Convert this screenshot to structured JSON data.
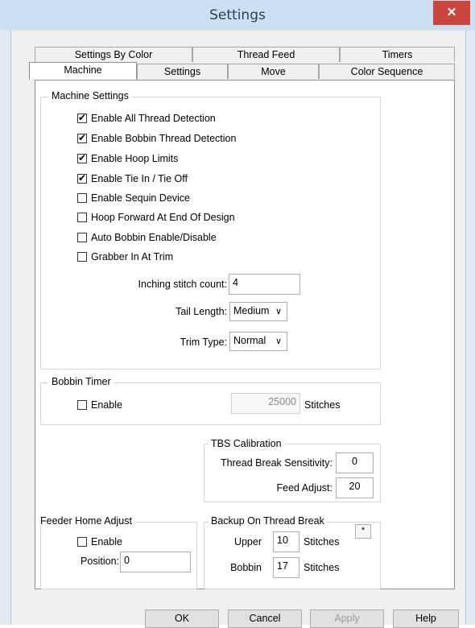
{
  "window": {
    "title": "Settings",
    "close_icon": "close-icon"
  },
  "tabs_row1": [
    "Settings By Color",
    "Thread Feed",
    "Timers"
  ],
  "tabs_row2": [
    "Machine",
    "Settings",
    "Move",
    "Color Sequence"
  ],
  "machine_settings": {
    "legend": "Machine Settings",
    "checkboxes": [
      {
        "label": "Enable All Thread Detection",
        "checked": true
      },
      {
        "label": "Enable Bobbin Thread Detection",
        "checked": true
      },
      {
        "label": "Enable Hoop Limits",
        "checked": true
      },
      {
        "label": "Enable Tie In / Tie Off",
        "checked": true
      },
      {
        "label": "Enable Sequin Device",
        "checked": false
      },
      {
        "label": "Hoop Forward At End Of Design",
        "checked": false
      },
      {
        "label": "Auto Bobbin Enable/Disable",
        "checked": false
      },
      {
        "label": "Grabber In At Trim",
        "checked": false
      }
    ],
    "inching_label": "Inching stitch count:",
    "inching_value": "4",
    "tail_label": "Tail Length:",
    "tail_value": "Medium",
    "trim_label": "Trim Type:",
    "trim_value": "Normal"
  },
  "bobbin_timer": {
    "legend": "Bobbin Timer",
    "enable_label": "Enable",
    "value": "25000",
    "unit": "Stitches"
  },
  "tbs_calibration": {
    "legend": "TBS Calibration",
    "sensitivity_label": "Thread Break Sensitivity:",
    "sensitivity_value": "0",
    "feed_label": "Feed Adjust:",
    "feed_value": "20"
  },
  "feeder_home": {
    "legend": "Feeder Home Adjust",
    "enable_label": "Enable",
    "position_label": "Position:",
    "position_value": "0"
  },
  "backup": {
    "legend": "Backup On Thread Break",
    "upper_label": "Upper",
    "upper_value": "10",
    "bobbin_label": "Bobbin",
    "bobbin_value": "17",
    "unit": "Stitches",
    "small_button": "*"
  },
  "buttons": {
    "ok": "OK",
    "cancel": "Cancel",
    "apply": "Apply",
    "help": "Help"
  }
}
